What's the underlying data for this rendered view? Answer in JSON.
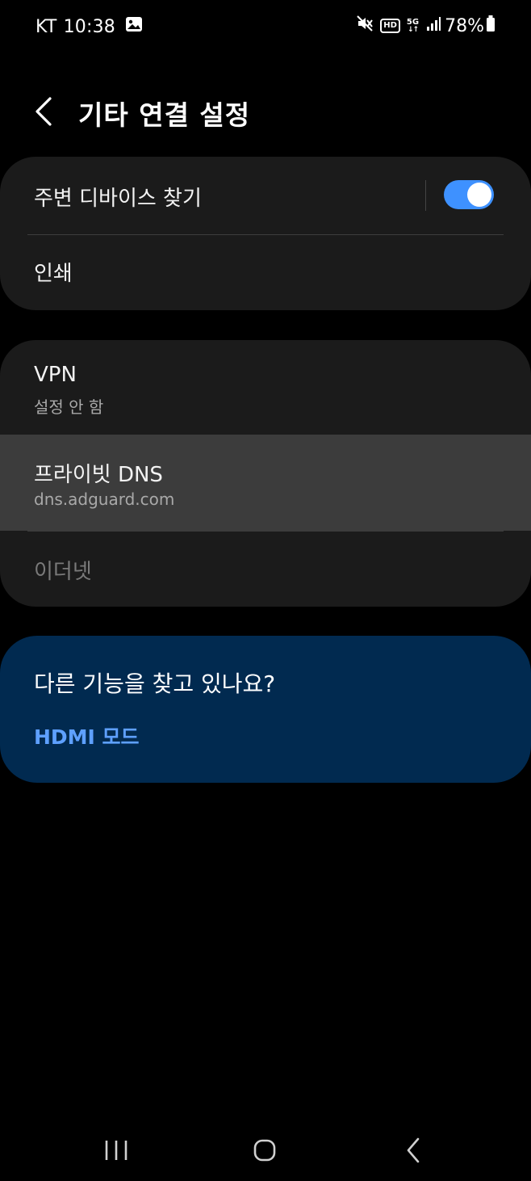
{
  "status_bar": {
    "carrier": "KT",
    "time": "10:38",
    "hd_label": "HD",
    "network_label": "5G",
    "network_arrows": "↓↑",
    "battery": "78%"
  },
  "header": {
    "title": "기타 연결 설정"
  },
  "group1": {
    "nearby_devices": {
      "title": "주변 디바이스 찾기",
      "enabled": true
    },
    "printing": {
      "title": "인쇄"
    }
  },
  "group2": {
    "vpn": {
      "title": "VPN",
      "subtitle": "설정 안 함"
    },
    "private_dns": {
      "title": "프라이빗 DNS",
      "subtitle": "dns.adguard.com"
    },
    "ethernet": {
      "title": "이더넷"
    }
  },
  "suggestion": {
    "title": "다른 기능을 찾고 있나요?",
    "link": "HDMI 모드"
  },
  "colors": {
    "background": "#000000",
    "card": "#1b1b1b",
    "pressed_row": "#3c3c3c",
    "toggle_on": "#3e91ff",
    "suggestion_card": "#012a50",
    "link": "#5ea0ff"
  },
  "icons": {
    "back": "chevron-left-icon",
    "gallery": "image-icon",
    "mute": "vibrate-mute-icon",
    "signal": "signal-bars-icon",
    "battery": "battery-icon",
    "recents": "recent-apps-icon",
    "home": "home-icon",
    "nav_back": "nav-back-icon"
  }
}
